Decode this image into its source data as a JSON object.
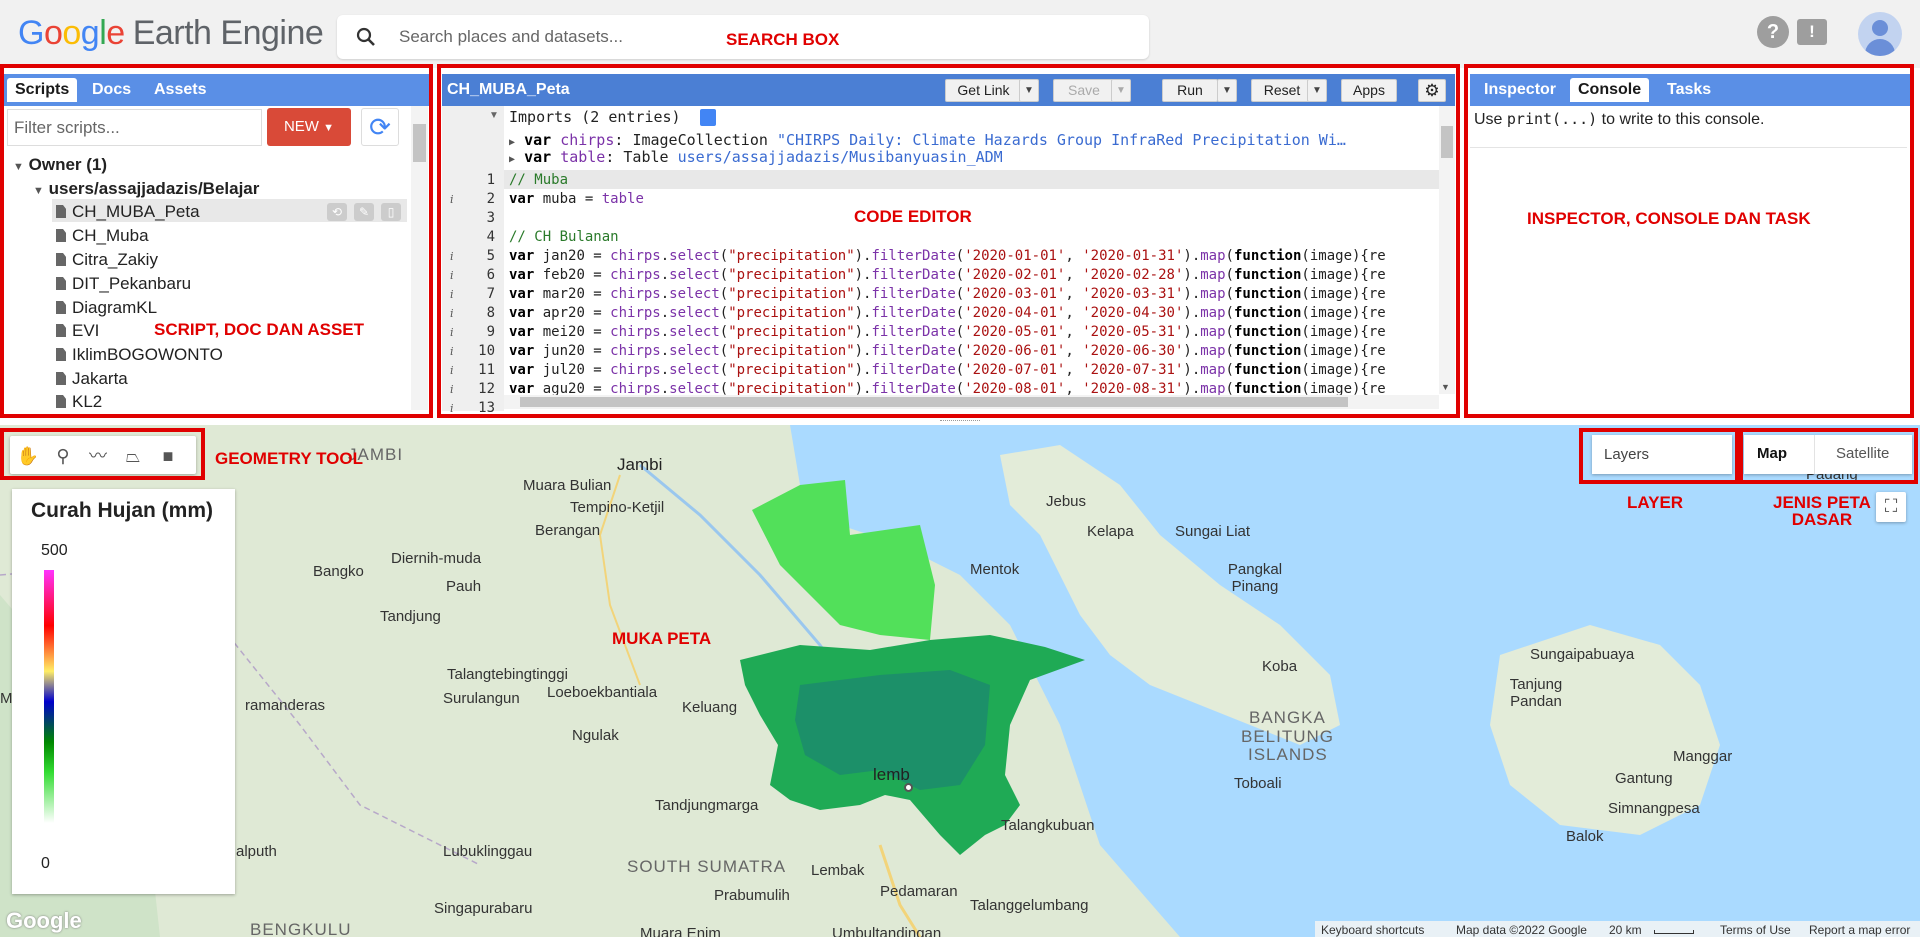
{
  "app": {
    "logo_google": [
      "G",
      "o",
      "o",
      "g",
      "l",
      "e"
    ],
    "logo_product": "Earth Engine"
  },
  "search": {
    "placeholder": "Search places and datasets..."
  },
  "top_icons": {
    "help": "?",
    "feedback": "!"
  },
  "scripts_panel": {
    "tabs": [
      "Scripts",
      "Docs",
      "Assets"
    ],
    "filter_placeholder": "Filter scripts...",
    "new_label": "NEW",
    "owner_label": "Owner (1)",
    "repo_label": "users/assajjadazis/Belajar",
    "files": [
      "CH_MUBA_Peta",
      "CH_Muba",
      "Citra_Zakiy",
      "DIT_Pekanbaru",
      "DiagramKL",
      "EVI",
      "IklimBOGOWONTO",
      "Jakarta",
      "KL2"
    ]
  },
  "editor": {
    "title": "CH_MUBA_Peta",
    "buttons": {
      "get_link": "Get Link",
      "save": "Save",
      "run": "Run",
      "reset": "Reset",
      "apps": "Apps"
    },
    "imports_header": "Imports (2 entries)",
    "imports": [
      {
        "kw": "var",
        "name": "chirps",
        "type": "ImageCollection",
        "value": "\"CHIRPS Daily: Climate Hazards Group InfraRed Precipitation Wi…"
      },
      {
        "kw": "var",
        "name": "table",
        "type": "Table",
        "value": "users/assajjadazis/Musibanyuasin_ADM"
      }
    ],
    "lines": [
      {
        "n": "1",
        "info": "",
        "text": "// Muba"
      },
      {
        "n": "2",
        "info": "i",
        "text": "var muba = table"
      },
      {
        "n": "3",
        "info": "",
        "text": ""
      },
      {
        "n": "4",
        "info": "",
        "text": "// CH Bulanan"
      },
      {
        "n": "5",
        "info": "i",
        "text": "var jan20 = chirps.select(\"precipitation\").filterDate('2020-01-01', '2020-01-31').map(function(image){re"
      },
      {
        "n": "6",
        "info": "i",
        "text": "var feb20 = chirps.select(\"precipitation\").filterDate('2020-02-01', '2020-02-28').map(function(image){re"
      },
      {
        "n": "7",
        "info": "i",
        "text": "var mar20 = chirps.select(\"precipitation\").filterDate('2020-03-01', '2020-03-31').map(function(image){re"
      },
      {
        "n": "8",
        "info": "i",
        "text": "var apr20 = chirps.select(\"precipitation\").filterDate('2020-04-01', '2020-04-30').map(function(image){re"
      },
      {
        "n": "9",
        "info": "i",
        "text": "var mei20 = chirps.select(\"precipitation\").filterDate('2020-05-01', '2020-05-31').map(function(image){re"
      },
      {
        "n": "10",
        "info": "i",
        "text": "var jun20 = chirps.select(\"precipitation\").filterDate('2020-06-01', '2020-06-30').map(function(image){re"
      },
      {
        "n": "11",
        "info": "i",
        "text": "var jul20 = chirps.select(\"precipitation\").filterDate('2020-07-01', '2020-07-31').map(function(image){re"
      },
      {
        "n": "12",
        "info": "i",
        "text": "var agu20 = chirps.select(\"precipitation\").filterDate('2020-08-01', '2020-08-31').map(function(image){re"
      },
      {
        "n": "13",
        "info": "i",
        "text": ""
      }
    ]
  },
  "right_panel": {
    "tabs": [
      "Inspector",
      "Console",
      "Tasks"
    ],
    "console_prefix": "Use ",
    "console_code": "print(...)",
    "console_suffix": " to write to this console."
  },
  "annotations": {
    "search_box": "SEARCH BOX",
    "code_editor": "CODE EDITOR",
    "scripts": "SCRIPT, DOC DAN ASSET",
    "inspector": "INSPECTOR, CONSOLE DAN TASK",
    "geometry": "GEOMETRY TOOL",
    "map_face": "MUKA PETA",
    "layer": "LAYER",
    "basemap_line1": "JENIS PETA",
    "basemap_line2": "DASAR"
  },
  "map": {
    "layers_label": "Layers",
    "map_btn": "Map",
    "satellite_btn": "Satellite",
    "legend_title": "Curah Hujan (mm)",
    "legend_max": "500",
    "legend_min": "0",
    "places": [
      "JAMBI",
      "Jambi",
      "Muara Bulian",
      "Tempino-Ketjil",
      "Berangan",
      "Diernih-muda",
      "Bangko",
      "Pauh",
      "Tandjung",
      "Talangtebingtinggi",
      "Surulangun",
      "Loeboekbantiala",
      "Keluang",
      "ramanderas",
      "Ngulak",
      "Tandjungmarga",
      "Lubuklinggau",
      "alputh",
      "SOUTH SUMATRA",
      "Lembak",
      "Prabumulih",
      "Pedamaran",
      "Singapurabaru",
      "Talanggelumbang",
      "Mentok",
      "Jebus",
      "Kelapa",
      "Sungai Liat",
      "Pangkal Pinang",
      "Koba",
      "BANGKA",
      "BELITUNG",
      "ISLANDS",
      "Toboali",
      "Sungaipabuaya",
      "Tanjung Pandan",
      "Manggar",
      "Gantung",
      "Simnangpesa",
      "Balok",
      "Talangkubuan",
      "Padang",
      "lemb",
      "Mu",
      "BENGKULU",
      "Muara Enim",
      "Umbultandingan"
    ],
    "google_mark": "Google",
    "footer": {
      "shortcuts": "Keyboard shortcuts",
      "data": "Map data ©2022 Google",
      "scale": "20 km",
      "terms": "Terms of Use",
      "report": "Report a map error"
    }
  }
}
